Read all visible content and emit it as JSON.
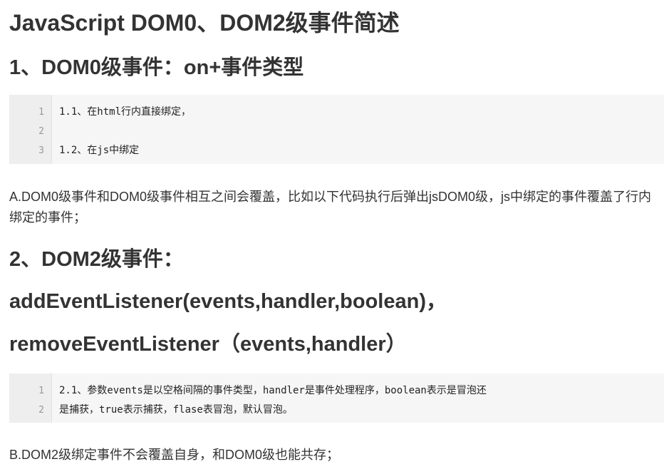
{
  "title": "JavaScript DOM0、DOM2级事件简述",
  "section1": {
    "heading": "1、DOM0级事件：on+事件类型",
    "code": {
      "line_numbers": [
        "1",
        "2",
        "3"
      ],
      "lines": [
        "1.1、在html行内直接绑定，",
        "",
        "1.2、在js中绑定"
      ]
    },
    "note": "A.DOM0级事件和DOM0级事件相互之间会覆盖，比如以下代码执行后弹出jsDOM0级，js中绑定的事件覆盖了行内绑定的事件；"
  },
  "section2": {
    "heading": "2、DOM2级事件：",
    "method1": "addEventListener(events,handler,boolean)，",
    "method2": "removeEventListener（events,handler）",
    "code": {
      "line_numbers": [
        "1",
        "2"
      ],
      "lines": [
        "2.1、参数events是以空格间隔的事件类型，handler是事件处理程序，boolean表示是冒泡还",
        "是捕获，true表示捕获，flase表冒泡，默认冒泡。"
      ]
    },
    "note": "B.DOM2级绑定事件不会覆盖自身，和DOM0级也能共存；"
  }
}
